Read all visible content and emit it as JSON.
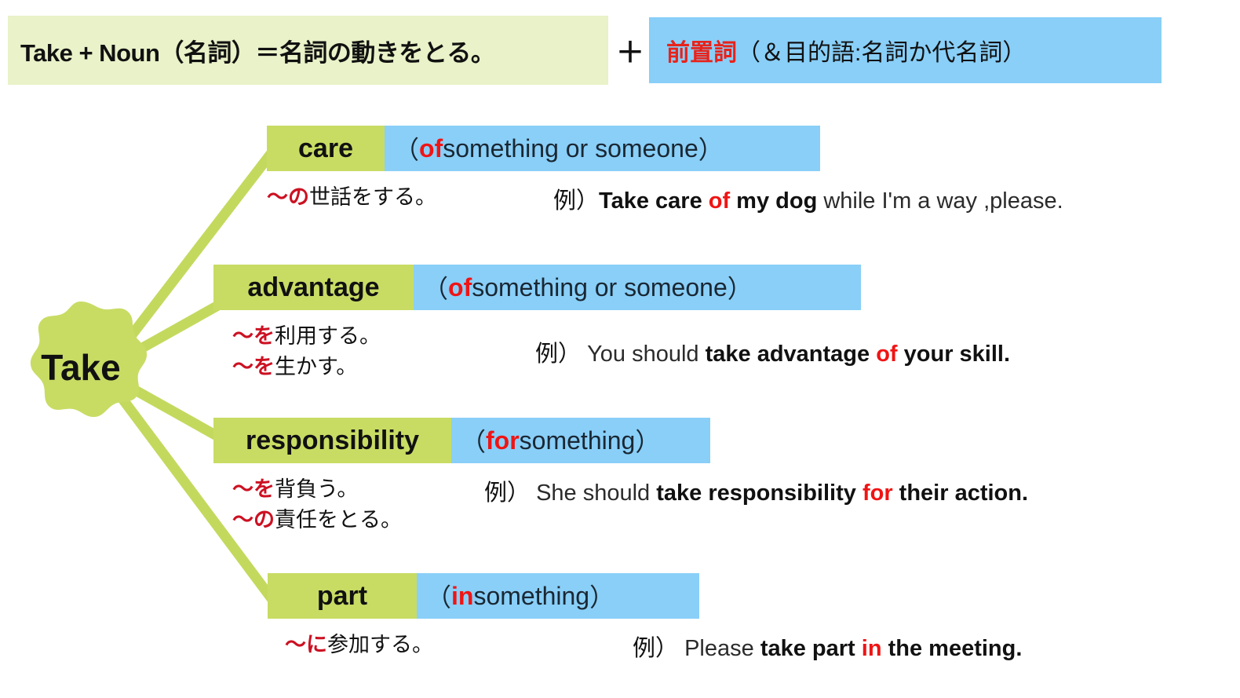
{
  "header": {
    "left_text": "Take + Noun（名詞）＝名詞の動きをとる。",
    "plus": "＋",
    "right_red": "前置詞",
    "right_rest": "（＆目的語:名詞か代名詞）",
    "green_bg": "#e9f2c8",
    "blue_bg": "#89cff8"
  },
  "root": {
    "label": "Take",
    "color": "#c8dc64"
  },
  "colors": {
    "green": "#c8dc64",
    "blue": "#89cff8",
    "red": "#f01414",
    "jp_red": "#cc1122",
    "line": "#c3d95e"
  },
  "entries": [
    {
      "noun": "care",
      "prep": "of",
      "object_text": "something or someone",
      "paren_open": "（",
      "paren_close": "）",
      "jp_lines": [
        {
          "red": "～の",
          "black": "世話をする。"
        }
      ],
      "example": {
        "mark": "例）",
        "pre": "",
        "bold_pre": "Take care ",
        "red": "of",
        "bold_post": " my dog",
        "tail": " while I'm a way ,please."
      }
    },
    {
      "noun": "advantage",
      "prep": "of",
      "object_text": "something or someone",
      "paren_open": "（",
      "paren_close": "）",
      "jp_lines": [
        {
          "red": "～を",
          "black": "利用する。"
        },
        {
          "red": "～を",
          "black": "生かす。"
        }
      ],
      "example": {
        "mark": "例）",
        "pre": " You should ",
        "bold_pre": "take advantage ",
        "red": "of",
        "bold_post": " your skill.",
        "tail": ""
      }
    },
    {
      "noun": "responsibility",
      "prep": "for",
      "object_text": "something ",
      "paren_open": "（",
      "paren_close": "）",
      "jp_lines": [
        {
          "red": "～を",
          "black": "背負う。"
        },
        {
          "red": "～の",
          "black": "責任をとる。"
        }
      ],
      "example": {
        "mark": "例）",
        "pre": " She should ",
        "bold_pre": "take responsibility ",
        "red": "for",
        "bold_post": " their action.",
        "tail": ""
      }
    },
    {
      "noun": "part",
      "prep": "in",
      "object_text": "something ",
      "paren_open": "（",
      "paren_close": "）",
      "jp_lines": [
        {
          "red": "～に",
          "black": "参加する。"
        }
      ],
      "example": {
        "mark": "例）",
        "pre": " Please ",
        "bold_pre": "take part ",
        "red": "in",
        "bold_post": " the meeting.",
        "tail": ""
      }
    }
  ]
}
